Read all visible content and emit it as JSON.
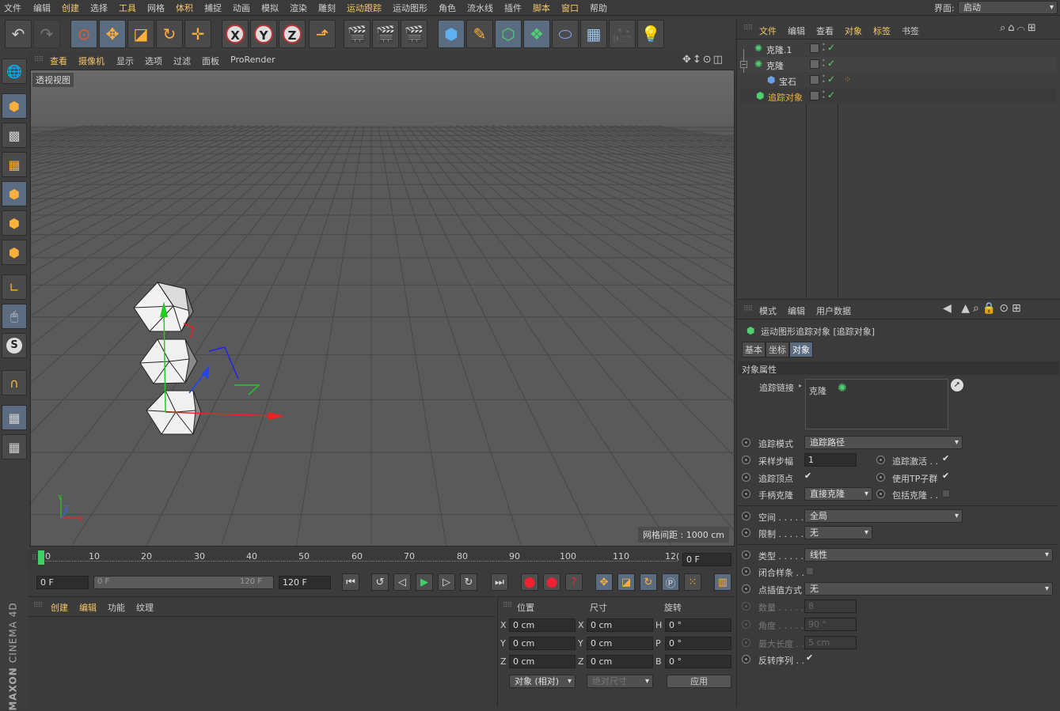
{
  "menu": [
    "文件",
    "编辑",
    "创建",
    "选择",
    "工具",
    "网格",
    "体积",
    "捕捉",
    "动画",
    "模拟",
    "渲染",
    "雕刻",
    "运动跟踪",
    "运动图形",
    "角色",
    "流水线",
    "插件",
    "脚本",
    "窗口",
    "帮助"
  ],
  "menu_highlight": [
    "创建",
    "工具",
    "体积",
    "运动跟踪",
    "脚本",
    "窗口"
  ],
  "layout_label": "界面:",
  "layout_value": "启动",
  "viewport": {
    "tabs": [
      "查看",
      "摄像机",
      "显示",
      "选项",
      "过滤",
      "面板",
      "ProRender"
    ],
    "view_name": "透视视图",
    "grid_spacing": "网格间距 : 1000 cm"
  },
  "timeline": {
    "ticks": [
      "0",
      "10",
      "20",
      "30",
      "40",
      "50",
      "60",
      "70",
      "80",
      "90",
      "100",
      "110",
      "12("
    ],
    "current_frame": "0 F",
    "start_frame": "0 F",
    "range_start": "0 F",
    "range_end": "120 F",
    "end_frame": "120 F"
  },
  "material_panel": {
    "tabs": [
      "创建",
      "编辑",
      "功能",
      "纹理"
    ]
  },
  "coords": {
    "headers": [
      "位置",
      "尺寸",
      "旋转"
    ],
    "rows": [
      {
        "a": "X",
        "pos": "0 cm",
        "b": "X",
        "size": "0 cm",
        "c": "H",
        "rot": "0 °"
      },
      {
        "a": "Y",
        "pos": "0 cm",
        "b": "Y",
        "size": "0 cm",
        "c": "P",
        "rot": "0 °"
      },
      {
        "a": "Z",
        "pos": "0 cm",
        "b": "Z",
        "size": "0 cm",
        "c": "B",
        "rot": "0 °"
      }
    ],
    "mode": "对象 (相对)",
    "size_mode": "绝对尺寸",
    "apply": "应用"
  },
  "object_manager": {
    "tabs": [
      "文件",
      "编辑",
      "查看",
      "对象",
      "标签",
      "书签"
    ],
    "objects": [
      {
        "name": "克隆.1",
        "color": "#d8d8d8"
      },
      {
        "name": "克隆",
        "color": "#d8d8d8"
      },
      {
        "name": "宝石",
        "color": "#d8d8d8"
      },
      {
        "name": "追踪对象",
        "color": "#f2b43a"
      }
    ]
  },
  "attributes": {
    "tabs": [
      "模式",
      "编辑",
      "用户数据"
    ],
    "object_title": "运动图形追踪对象 [追踪对象]",
    "subtabs": [
      "基本",
      "坐标",
      "对象"
    ],
    "section": "对象属性",
    "trace_link_label": "追踪链接",
    "trace_link_value": "克隆",
    "fields": {
      "trace_mode_label": "追踪模式",
      "trace_mode": "追踪路径",
      "sampling_label": "采样步幅",
      "sampling": "1",
      "trace_active_label": "追踪激活 . .",
      "trace_vertex_label": "追踪顶点",
      "use_tp_label": "使用TP子群",
      "handle_clone_label": "手柄克隆",
      "handle_clone": "直接克隆",
      "include_clone_label": "包括克隆 . .",
      "space_label": "空间 . . . . .",
      "space": "全局",
      "limit_label": "限制 . . . . .",
      "limit": "无",
      "type_label": "类型 . . . . . .",
      "type": "线性",
      "close_spline_label": "闭合样条 . .",
      "interp_label": "点插值方式",
      "interp": "无",
      "count_label": "数量 . . . . .",
      "count": "8",
      "angle_label": "角度 . . . . .",
      "angle": "90 °",
      "maxlen_label": "最大长度 . .",
      "maxlen": "5 cm",
      "reverse_label": "反转序列 . ."
    }
  },
  "brand": {
    "maxon": "MAXON",
    "product": "CINEMA 4D"
  }
}
